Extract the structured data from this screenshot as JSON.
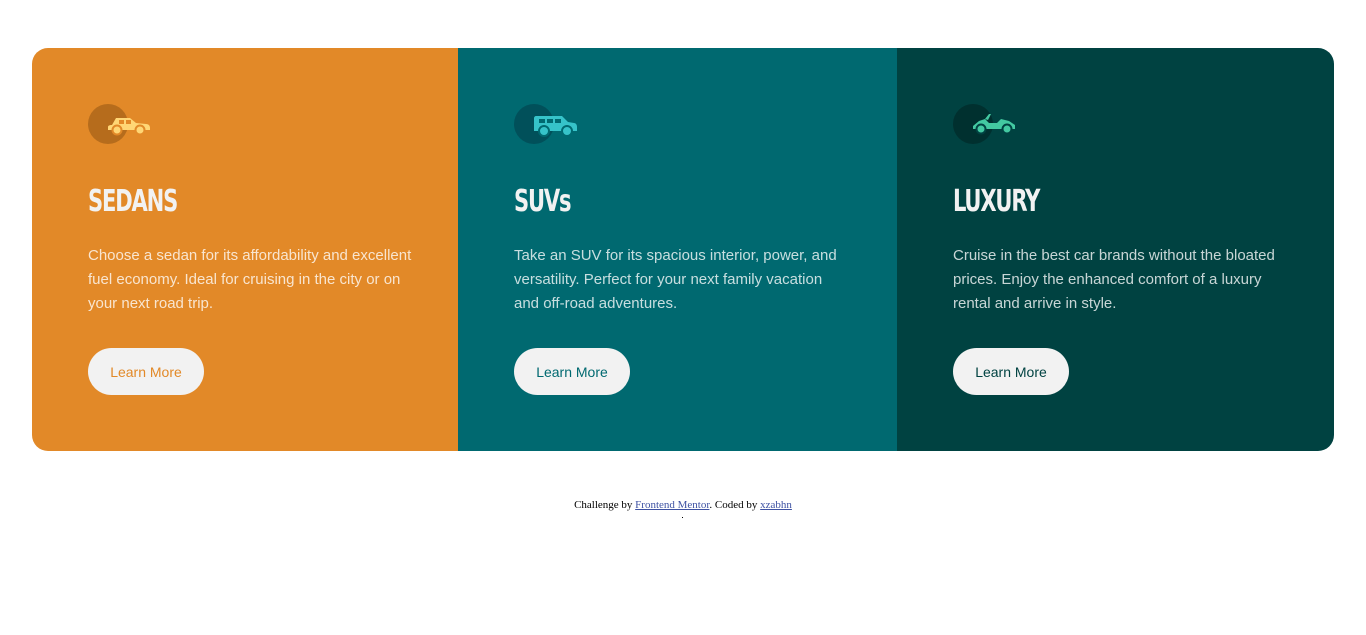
{
  "cards": [
    {
      "id": "sedans",
      "title": "SEDANS",
      "text": "Choose a sedan for its affordability and excellent fuel economy. Ideal for cruising in the city or on your next road trip.",
      "button_label": "Learn More",
      "icon": "sedan-car-icon",
      "background": "#e28928"
    },
    {
      "id": "suvs",
      "title": "SUVs",
      "text": "Take an SUV for its spacious interior, power, and versatility. Perfect for your next family vacation and off-road adventures.",
      "button_label": "Learn More",
      "icon": "suv-car-icon",
      "background": "#006970"
    },
    {
      "id": "luxury",
      "title": "LUXURY",
      "text": "Cruise in the best car brands without the bloated prices. Enjoy the enhanced comfort of a luxury rental and arrive in style.",
      "button_label": "Learn More",
      "icon": "luxury-car-icon",
      "background": "#004241"
    }
  ],
  "footer": {
    "prefix": "Challenge by ",
    "mentor_link": "Frontend Mentor",
    "middle": ". Coded by ",
    "author_link": "xzabhn"
  }
}
